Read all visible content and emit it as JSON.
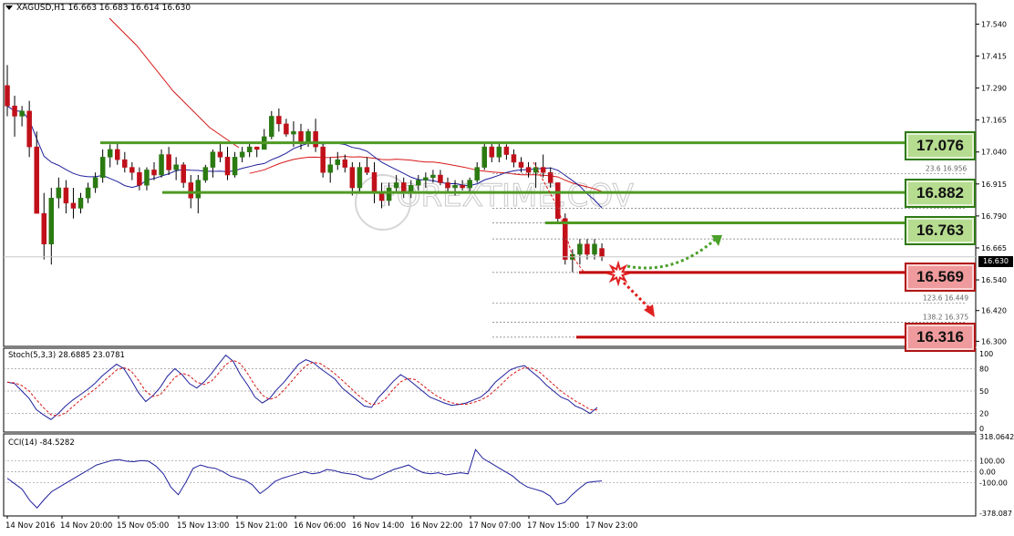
{
  "window": {
    "symbol_line": "XAGUSD,H1  16.663 16.683 16.614 16.630"
  },
  "price_axis": {
    "ticks": [
      "17.540",
      "17.415",
      "17.290",
      "17.165",
      "17.040",
      "16.915",
      "16.790",
      "16.665",
      "16.540",
      "16.420",
      "16.300"
    ],
    "current_price": "16.630"
  },
  "time_axis": {
    "labels": [
      "14 Nov 2016",
      "14 Nov 20:00",
      "15 Nov 05:00",
      "15 Nov 13:00",
      "15 Nov 21:00",
      "16 Nov 06:00",
      "16 Nov 14:00",
      "16 Nov 22:00",
      "17 Nov 07:00",
      "17 Nov 15:00",
      "17 Nov 23:00"
    ]
  },
  "watermark": "FOREXTIME.COV",
  "fib_labels": [
    "23.6  16.956",
    "123.6  16.449",
    "138.2  16.375"
  ],
  "levels": {
    "resistance": [
      "17.076",
      "16.882",
      "16.763"
    ],
    "support": [
      "16.569",
      "16.316"
    ]
  },
  "stoch": {
    "label": "Stoch(5,3,3) 28.6885 23.0781",
    "ticks": [
      "100",
      "80",
      "50",
      "20",
      "0"
    ]
  },
  "cci": {
    "label": "CCI(14) -84.5282",
    "ticks": [
      "318.0642",
      "100.00",
      "0.00",
      "-100.00",
      "-378.087"
    ]
  },
  "colors": {
    "bull": "#2b7a12",
    "bear": "#c0101a",
    "ma_fast": "#1f1f9c",
    "ma_slow": "#d81818",
    "level_green": "#4f9a24",
    "level_red": "#c00000",
    "signal_up": "#4aa02a",
    "signal_down": "#e02020"
  },
  "chart_data": {
    "type": "candlestick",
    "symbol": "XAGUSD",
    "timeframe": "H1",
    "ohlc_last": {
      "open": 16.663,
      "high": 16.683,
      "low": 16.614,
      "close": 16.63
    },
    "ylim": [
      16.28,
      17.62
    ],
    "horizontal_levels": [
      17.076,
      16.882,
      16.763,
      16.569,
      16.316
    ],
    "candles": [
      {
        "o": 17.3,
        "h": 17.38,
        "l": 17.18,
        "c": 17.22
      },
      {
        "o": 17.22,
        "h": 17.26,
        "l": 17.1,
        "c": 17.18
      },
      {
        "o": 17.18,
        "h": 17.22,
        "l": 17.14,
        "c": 17.2
      },
      {
        "o": 17.2,
        "h": 17.24,
        "l": 17.02,
        "c": 17.06
      },
      {
        "o": 17.06,
        "h": 17.12,
        "l": 16.85,
        "c": 16.8
      },
      {
        "o": 16.8,
        "h": 16.88,
        "l": 16.62,
        "c": 16.68
      },
      {
        "o": 16.68,
        "h": 16.9,
        "l": 16.6,
        "c": 16.86
      },
      {
        "o": 16.86,
        "h": 16.94,
        "l": 16.82,
        "c": 16.9
      },
      {
        "o": 16.9,
        "h": 16.93,
        "l": 16.8,
        "c": 16.84
      },
      {
        "o": 16.84,
        "h": 16.9,
        "l": 16.78,
        "c": 16.82
      },
      {
        "o": 16.82,
        "h": 16.88,
        "l": 16.8,
        "c": 16.86
      },
      {
        "o": 16.86,
        "h": 16.92,
        "l": 16.84,
        "c": 16.9
      },
      {
        "o": 16.9,
        "h": 16.96,
        "l": 16.88,
        "c": 16.94
      },
      {
        "o": 16.94,
        "h": 17.05,
        "l": 16.92,
        "c": 17.02
      },
      {
        "o": 17.02,
        "h": 17.07,
        "l": 16.98,
        "c": 17.05
      },
      {
        "o": 17.05,
        "h": 17.08,
        "l": 16.99,
        "c": 17.01
      },
      {
        "o": 17.01,
        "h": 17.04,
        "l": 16.96,
        "c": 16.98
      },
      {
        "o": 16.98,
        "h": 17.0,
        "l": 16.93,
        "c": 16.96
      },
      {
        "o": 16.96,
        "h": 16.98,
        "l": 16.89,
        "c": 16.91
      },
      {
        "o": 16.91,
        "h": 16.98,
        "l": 16.89,
        "c": 16.97
      },
      {
        "o": 16.97,
        "h": 17.0,
        "l": 16.93,
        "c": 16.95
      },
      {
        "o": 16.95,
        "h": 17.05,
        "l": 16.94,
        "c": 17.03
      },
      {
        "o": 17.03,
        "h": 17.06,
        "l": 16.95,
        "c": 16.97
      },
      {
        "o": 16.97,
        "h": 17.02,
        "l": 16.93,
        "c": 16.99
      },
      {
        "o": 16.99,
        "h": 17.0,
        "l": 16.9,
        "c": 16.92
      },
      {
        "o": 16.92,
        "h": 16.95,
        "l": 16.82,
        "c": 16.86
      },
      {
        "o": 16.86,
        "h": 16.95,
        "l": 16.8,
        "c": 16.93
      },
      {
        "o": 16.93,
        "h": 16.99,
        "l": 16.92,
        "c": 16.98
      },
      {
        "o": 16.98,
        "h": 17.05,
        "l": 16.94,
        "c": 17.04
      },
      {
        "o": 17.04,
        "h": 17.08,
        "l": 17.0,
        "c": 17.02
      },
      {
        "o": 17.02,
        "h": 17.06,
        "l": 16.93,
        "c": 16.95
      },
      {
        "o": 16.95,
        "h": 17.04,
        "l": 16.94,
        "c": 17.02
      },
      {
        "o": 17.02,
        "h": 17.06,
        "l": 17.0,
        "c": 17.04
      },
      {
        "o": 17.04,
        "h": 17.08,
        "l": 17.02,
        "c": 17.06
      },
      {
        "o": 17.06,
        "h": 17.06,
        "l": 17.02,
        "c": 17.05
      },
      {
        "o": 17.05,
        "h": 17.13,
        "l": 17.05,
        "c": 17.1
      },
      {
        "o": 17.1,
        "h": 17.2,
        "l": 17.09,
        "c": 17.18
      },
      {
        "o": 17.18,
        "h": 17.21,
        "l": 17.12,
        "c": 17.15
      },
      {
        "o": 17.15,
        "h": 17.17,
        "l": 17.1,
        "c": 17.11
      },
      {
        "o": 17.11,
        "h": 17.16,
        "l": 17.06,
        "c": 17.12
      },
      {
        "o": 17.12,
        "h": 17.15,
        "l": 17.05,
        "c": 17.08
      },
      {
        "o": 17.08,
        "h": 17.13,
        "l": 17.06,
        "c": 17.12
      },
      {
        "o": 17.12,
        "h": 17.17,
        "l": 17.04,
        "c": 17.06
      },
      {
        "o": 17.06,
        "h": 17.08,
        "l": 16.94,
        "c": 16.96
      },
      {
        "o": 16.96,
        "h": 17.02,
        "l": 16.92,
        "c": 16.99
      },
      {
        "o": 16.99,
        "h": 17.04,
        "l": 16.97,
        "c": 17.01
      },
      {
        "o": 17.01,
        "h": 17.03,
        "l": 16.96,
        "c": 16.98
      },
      {
        "o": 16.98,
        "h": 17.0,
        "l": 16.87,
        "c": 16.9
      },
      {
        "o": 16.9,
        "h": 17.0,
        "l": 16.88,
        "c": 16.98
      },
      {
        "o": 16.98,
        "h": 17.02,
        "l": 16.95,
        "c": 16.96
      },
      {
        "o": 16.96,
        "h": 17.0,
        "l": 16.84,
        "c": 16.88
      },
      {
        "o": 16.88,
        "h": 16.92,
        "l": 16.82,
        "c": 16.85
      },
      {
        "o": 16.85,
        "h": 16.92,
        "l": 16.83,
        "c": 16.9
      },
      {
        "o": 16.9,
        "h": 16.95,
        "l": 16.88,
        "c": 16.92
      },
      {
        "o": 16.92,
        "h": 16.94,
        "l": 16.86,
        "c": 16.88
      },
      {
        "o": 16.88,
        "h": 16.93,
        "l": 16.86,
        "c": 16.91
      },
      {
        "o": 16.91,
        "h": 16.95,
        "l": 16.89,
        "c": 16.93
      },
      {
        "o": 16.93,
        "h": 16.96,
        "l": 16.9,
        "c": 16.94
      },
      {
        "o": 16.94,
        "h": 16.97,
        "l": 16.92,
        "c": 16.95
      },
      {
        "o": 16.95,
        "h": 16.97,
        "l": 16.91,
        "c": 16.92
      },
      {
        "o": 16.92,
        "h": 16.94,
        "l": 16.88,
        "c": 16.9
      },
      {
        "o": 16.9,
        "h": 16.93,
        "l": 16.87,
        "c": 16.91
      },
      {
        "o": 16.91,
        "h": 16.93,
        "l": 16.89,
        "c": 16.9
      },
      {
        "o": 16.9,
        "h": 16.94,
        "l": 16.88,
        "c": 16.93
      },
      {
        "o": 16.93,
        "h": 17.0,
        "l": 16.92,
        "c": 16.98
      },
      {
        "o": 16.98,
        "h": 17.08,
        "l": 16.97,
        "c": 17.06
      },
      {
        "o": 17.06,
        "h": 17.08,
        "l": 17.0,
        "c": 17.02
      },
      {
        "o": 17.02,
        "h": 17.08,
        "l": 17.0,
        "c": 17.06
      },
      {
        "o": 17.06,
        "h": 17.07,
        "l": 17.01,
        "c": 17.03
      },
      {
        "o": 17.03,
        "h": 17.05,
        "l": 16.98,
        "c": 17.0
      },
      {
        "o": 17.0,
        "h": 17.02,
        "l": 16.96,
        "c": 16.98
      },
      {
        "o": 16.98,
        "h": 17.0,
        "l": 16.94,
        "c": 16.96
      },
      {
        "o": 16.96,
        "h": 17.0,
        "l": 16.9,
        "c": 16.98
      },
      {
        "o": 16.98,
        "h": 17.03,
        "l": 16.94,
        "c": 16.96
      },
      {
        "o": 16.96,
        "h": 16.98,
        "l": 16.9,
        "c": 16.92
      },
      {
        "o": 16.92,
        "h": 16.92,
        "l": 16.76,
        "c": 16.78
      },
      {
        "o": 16.78,
        "h": 16.8,
        "l": 16.6,
        "c": 16.62
      },
      {
        "o": 16.62,
        "h": 16.66,
        "l": 16.57,
        "c": 16.64
      },
      {
        "o": 16.64,
        "h": 16.7,
        "l": 16.6,
        "c": 16.68
      },
      {
        "o": 16.68,
        "h": 16.7,
        "l": 16.62,
        "c": 16.64
      },
      {
        "o": 16.64,
        "h": 16.7,
        "l": 16.62,
        "c": 16.68
      },
      {
        "o": 16.663,
        "h": 16.683,
        "l": 16.614,
        "c": 16.63
      }
    ]
  }
}
